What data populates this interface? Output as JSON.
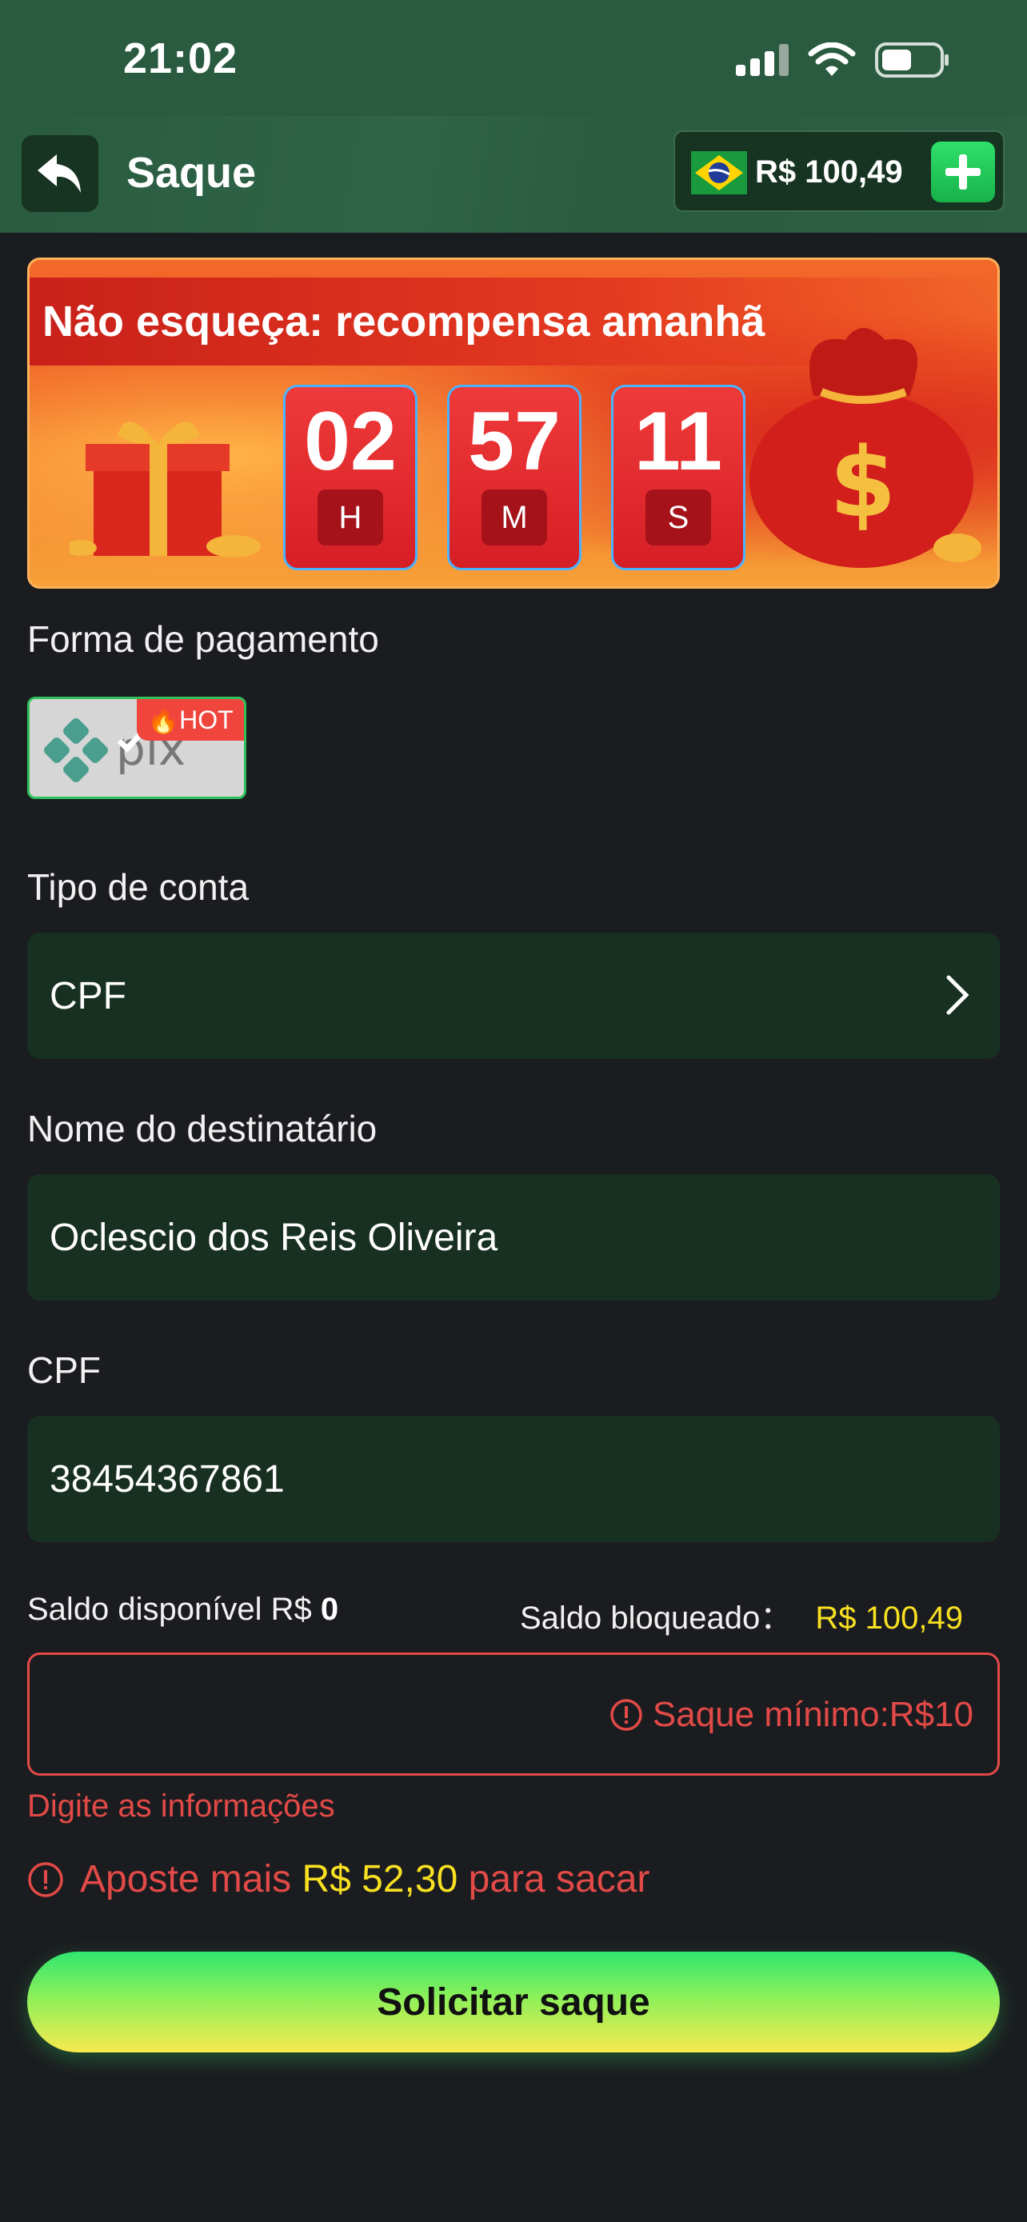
{
  "status_bar": {
    "time": "21:02"
  },
  "header": {
    "title": "Saque",
    "balance": "R$ 100,49"
  },
  "banner": {
    "title": "Não esqueça: recompensa amanhã",
    "timer": [
      {
        "value": "02",
        "unit": "H"
      },
      {
        "value": "57",
        "unit": "M"
      },
      {
        "value": "11",
        "unit": "S"
      }
    ]
  },
  "payment": {
    "label": "Forma de pagamento",
    "method_logo": "pix",
    "badge": "HOT"
  },
  "account_type": {
    "label": "Tipo de conta",
    "value": "CPF"
  },
  "recipient": {
    "label": "Nome do destinatário",
    "value": "Oclescio dos Reis Oliveira"
  },
  "cpf": {
    "label": "CPF",
    "value": "38454367861"
  },
  "saldo": {
    "available_label": "Saldo disponível R$",
    "available_value": "0",
    "blocked_label": "Saldo bloqueado：",
    "blocked_value": "R$ 100,49"
  },
  "amount": {
    "placeholder": "Saque mínimo:R$10"
  },
  "errors": {
    "fill_info": "Digite as informações",
    "bet_prefix": "Aposte mais",
    "bet_amount": "R$ 52,30",
    "bet_suffix": "para sacar"
  },
  "submit_label": "Solicitar saque",
  "colors": {
    "accent_green": "#2fe06a",
    "error_red": "#e24a47",
    "highlight_yellow": "#f8e022"
  }
}
